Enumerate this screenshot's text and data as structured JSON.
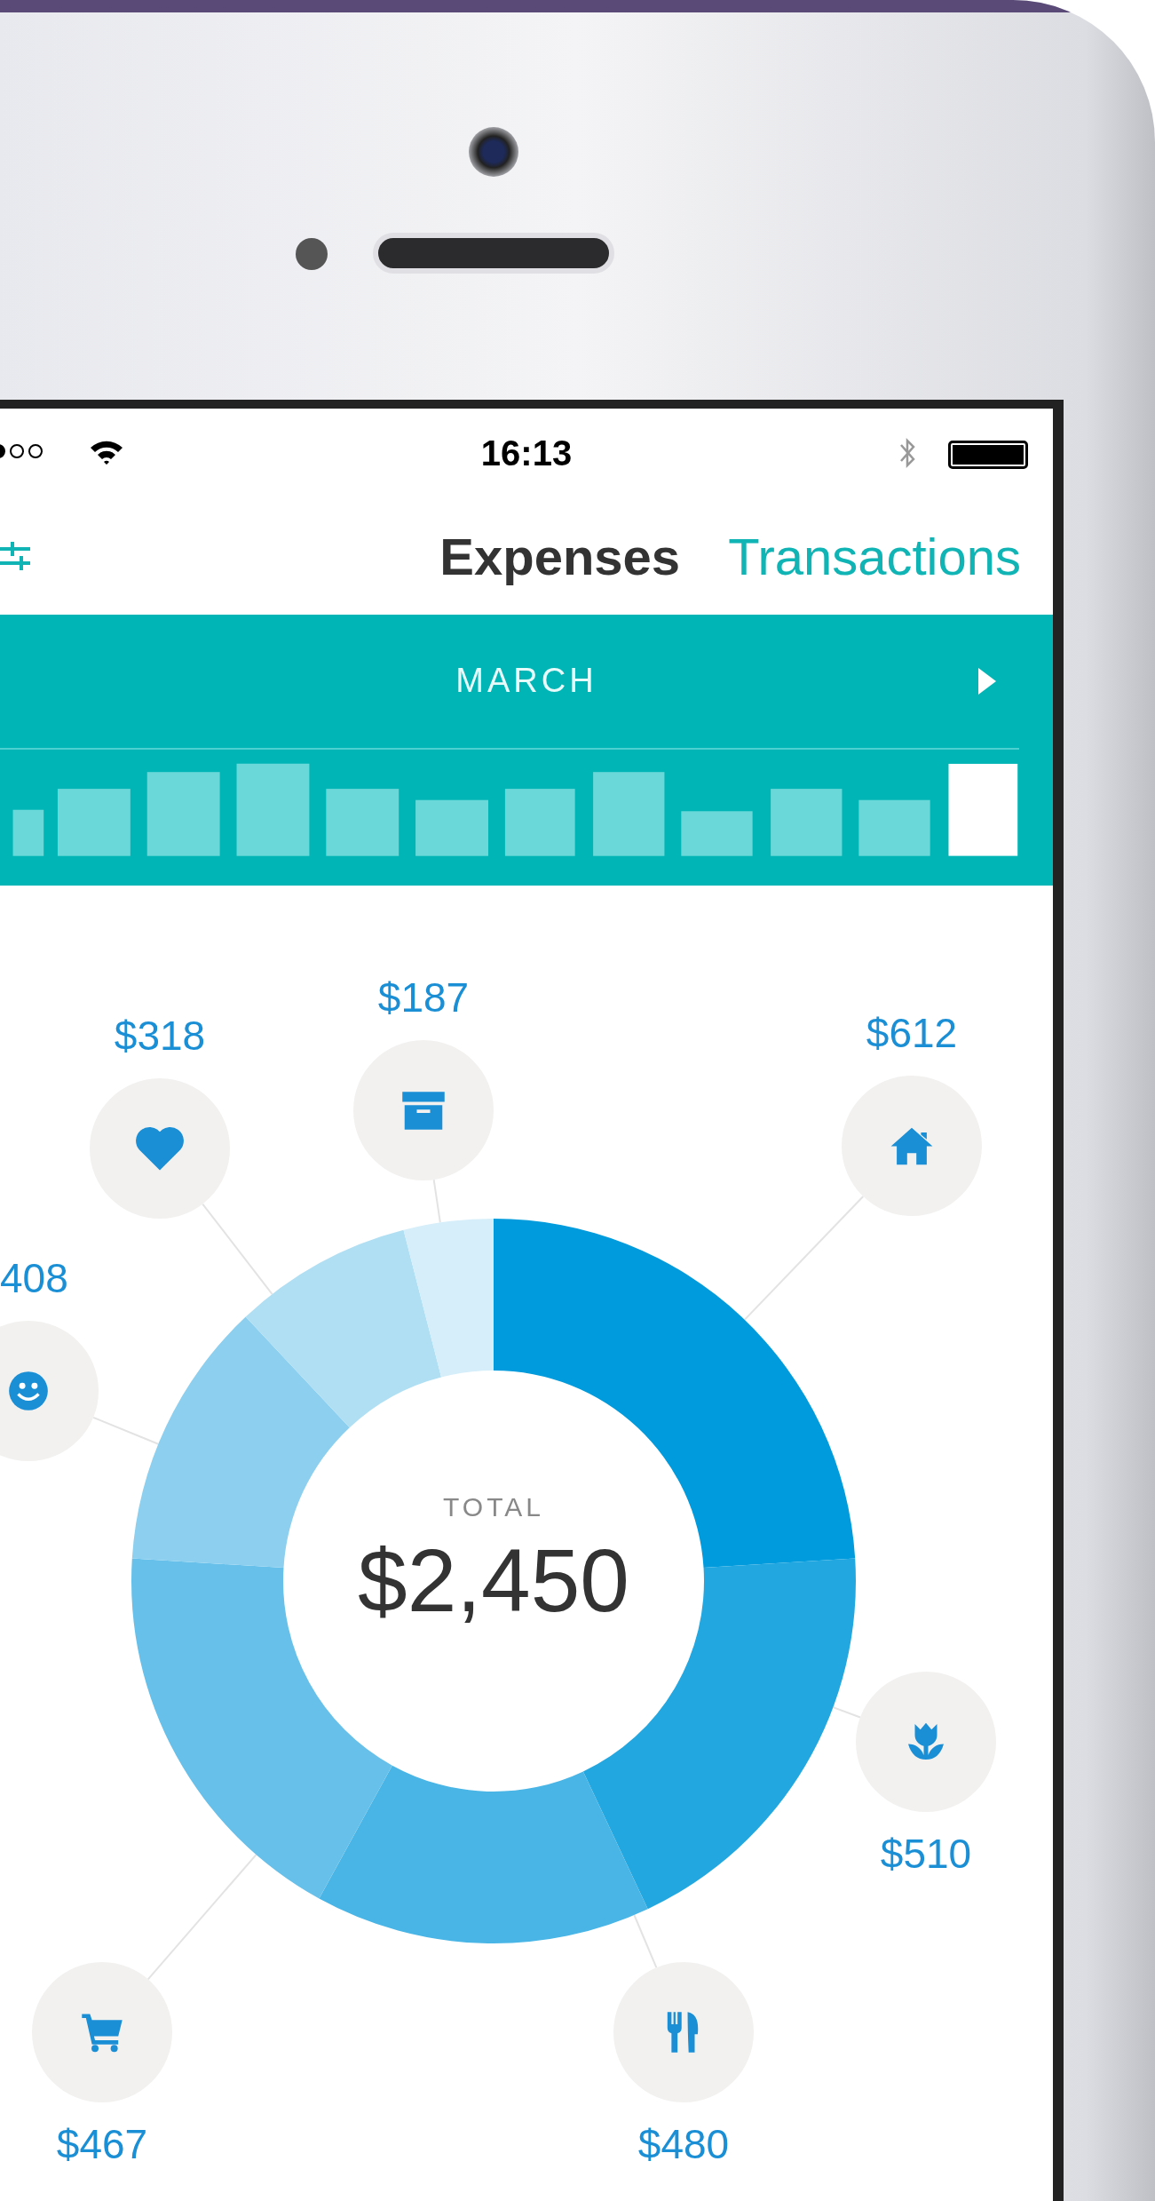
{
  "status_bar": {
    "time": "16:13"
  },
  "nav": {
    "tabs": [
      {
        "label": "Expenses",
        "selected": true
      },
      {
        "label": "Transactions",
        "selected": false
      }
    ]
  },
  "period": {
    "month": "MARCH"
  },
  "chart": {
    "total_label": "TOTAL",
    "total": "$2,450",
    "chart_data": {
      "type": "donut",
      "values": [
        24,
        19,
        15,
        18,
        12,
        8,
        4
      ],
      "colors": [
        "#009bdc",
        "#22a7e0",
        "#48b5e6",
        "#66c0ea",
        "#8ccfef",
        "#b0dff4",
        "#d5eef9"
      ]
    },
    "categories": [
      {
        "kind": "home",
        "amount": "$612"
      },
      {
        "kind": "flower",
        "amount": "$510"
      },
      {
        "kind": "food",
        "amount": "$480"
      },
      {
        "kind": "cart",
        "amount": "$467"
      },
      {
        "kind": "smile",
        "amount": "408"
      },
      {
        "kind": "heart",
        "amount": "$318"
      },
      {
        "kind": "box",
        "amount": "$187"
      }
    ]
  }
}
